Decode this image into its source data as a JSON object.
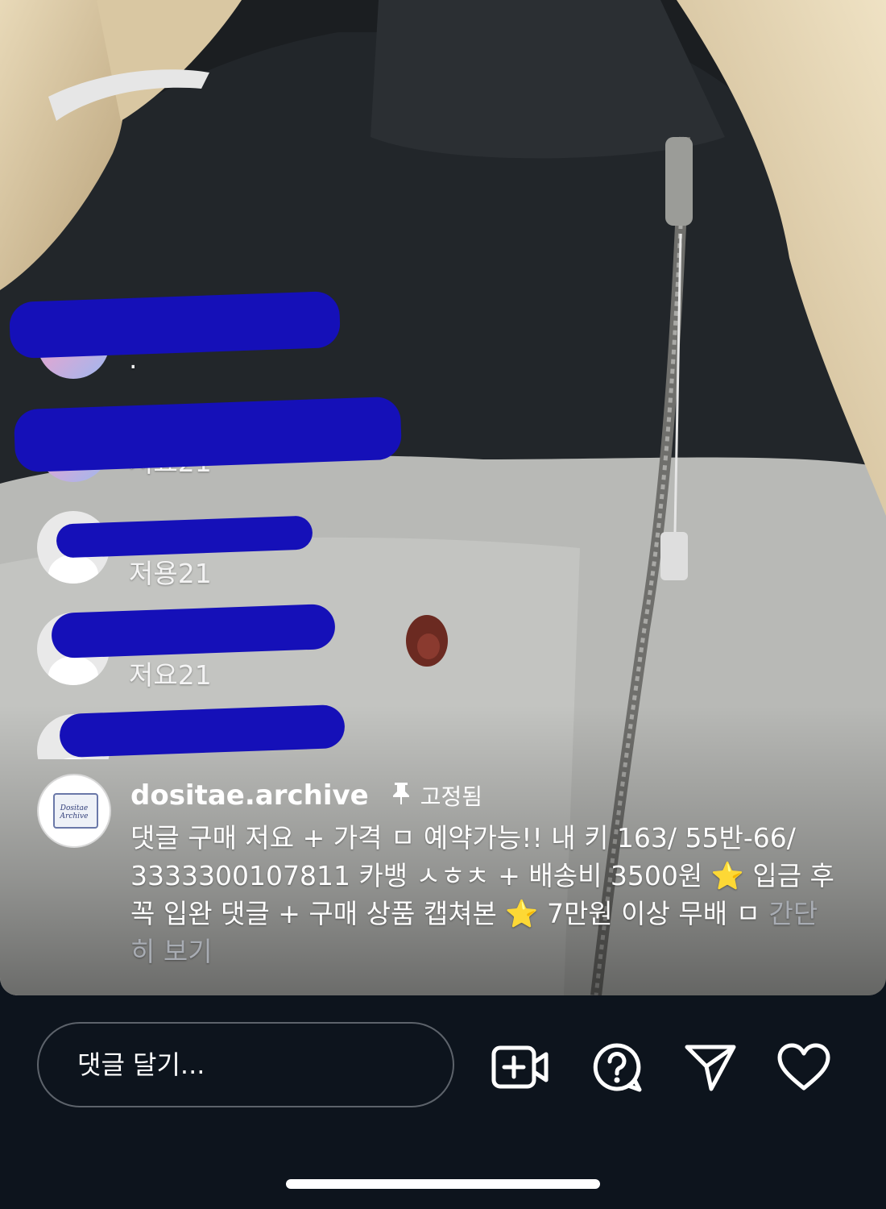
{
  "comments": [
    {
      "username": "",
      "text": "."
    },
    {
      "username": "",
      "text": "저요21"
    },
    {
      "username": "",
      "text": "저용21"
    },
    {
      "username": "",
      "text": "저요21"
    },
    {
      "username": "",
      "text": ""
    }
  ],
  "pinned": {
    "username": "dositae.archive",
    "pin_icon": "pushpin-icon",
    "pin_label": "고정됨",
    "avatar_logo_text": "Dositae Archive",
    "text": "댓글 구매 저요 + 가격 ㅁ 예약가능!! 내 키 163/ 55반-66/ 3333300107811 카뱅 ㅅㅎㅊ + 배송비 3500원 ⭐ 입금 후 꼭 입완 댓글 + 구매 상품 캡쳐본 ⭐ 7만원 이상 무배 ㅁ",
    "more_label": "간단히 보기"
  },
  "composer": {
    "placeholder": "댓글 달기..."
  },
  "actions": [
    {
      "icon": "add-video-icon"
    },
    {
      "icon": "question-bubble-icon"
    },
    {
      "icon": "send-icon"
    },
    {
      "icon": "heart-icon"
    }
  ],
  "colors": {
    "redaction": "#1510b8",
    "background": "#0d141d"
  }
}
